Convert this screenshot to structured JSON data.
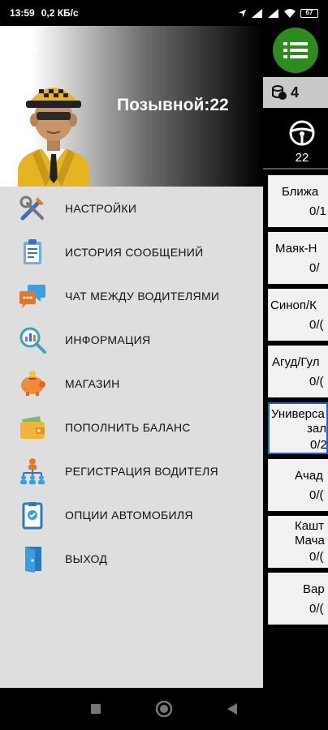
{
  "status_bar": {
    "time": "13:59",
    "speed": "0,2 КБ/с",
    "battery": "67"
  },
  "drawer": {
    "callsign": "Позывной:22",
    "menu": [
      {
        "label": "НАСТРОЙКИ",
        "icon": "tools-icon"
      },
      {
        "label": "ИСТОРИЯ СООБЩЕНИЙ",
        "icon": "clipboard-icon"
      },
      {
        "label": "ЧАТ МЕЖДУ ВОДИТЕЛЯМИ",
        "icon": "chat-bubbles-icon"
      },
      {
        "label": "ИНФОРМАЦИЯ",
        "icon": "magnifier-chart-icon"
      },
      {
        "label": "МАГАЗИН",
        "icon": "piggy-bank-icon"
      },
      {
        "label": "ПОПОЛНИТЬ БАЛАНС",
        "icon": "wallet-icon"
      },
      {
        "label": "РЕГИСТРАЦИЯ ВОДИТЕЛЯ",
        "icon": "org-chart-icon"
      },
      {
        "label": "ОПЦИИ АВТОМОБИЛЯ",
        "icon": "car-options-icon"
      },
      {
        "label": "ВЫХОД",
        "icon": "exit-door-icon"
      }
    ]
  },
  "background": {
    "balance": "4",
    "wheel_count": "22",
    "zones": [
      {
        "name": "Ближа",
        "count": "0/1"
      },
      {
        "name": "Маяк-Н",
        "count": "0/"
      },
      {
        "name": "Синоп/К",
        "count": "0/("
      },
      {
        "name": "Агуд/Гул",
        "count": "0/("
      },
      {
        "name": "Универса",
        "name2": "зал",
        "count": "0/2",
        "selected": true
      },
      {
        "name": "Ачад",
        "count": "0/("
      },
      {
        "name": "Кашт",
        "name2": "Мача",
        "count": "0/("
      },
      {
        "name": "Вар",
        "count": "0/("
      }
    ]
  },
  "colors": {
    "fab": "#2e8b1e",
    "drawer_bg": "#dedede",
    "selected_border": "#1e5ed8"
  }
}
